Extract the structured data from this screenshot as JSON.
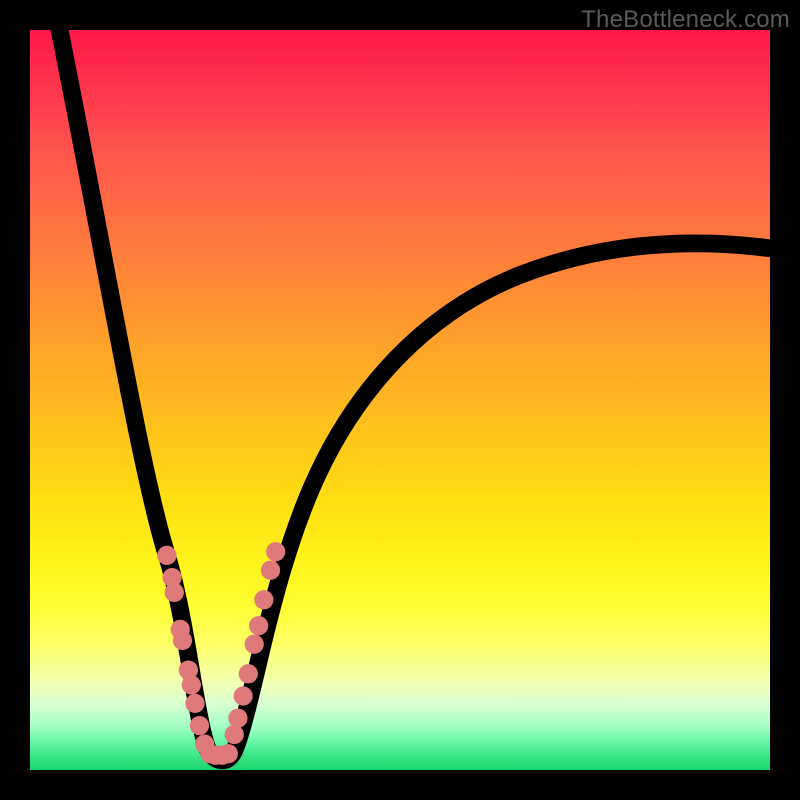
{
  "watermark": "TheBottleneck.com",
  "colors": {
    "background": "#000000",
    "dot_fill": "#e07a7a",
    "curve_stroke": "#000000",
    "gradient_top": "#ff1749",
    "gradient_bottom": "#1bd76c"
  },
  "chart_data": {
    "type": "line",
    "title": "",
    "xlabel": "",
    "ylabel": "",
    "xlim": [
      0,
      100
    ],
    "ylim": [
      0,
      100
    ],
    "series": [
      {
        "name": "bottleneck-curve",
        "curve": {
          "description": "V-shaped curve starting top-left, dipping to a flat minimum near x≈25, rising to top-right with a shallower right arm that tapers near y≈70 at x=100",
          "min_x": 25,
          "min_y": 2,
          "left_endpoint_y": 100,
          "right_endpoint_y": 70,
          "flat_bottom_width": 4
        }
      }
    ],
    "marker_points_left": [
      {
        "x": 18.5,
        "y": 29
      },
      {
        "x": 19.2,
        "y": 26
      },
      {
        "x": 19.5,
        "y": 24
      },
      {
        "x": 20.3,
        "y": 19
      },
      {
        "x": 20.6,
        "y": 17.5
      },
      {
        "x": 21.4,
        "y": 13.5
      },
      {
        "x": 21.8,
        "y": 11.5
      },
      {
        "x": 22.3,
        "y": 9
      },
      {
        "x": 22.9,
        "y": 6
      },
      {
        "x": 23.6,
        "y": 3.5
      }
    ],
    "marker_points_bottom": [
      {
        "x": 24.3,
        "y": 2.2
      },
      {
        "x": 25.1,
        "y": 2.0
      },
      {
        "x": 26.0,
        "y": 2.0
      },
      {
        "x": 26.8,
        "y": 2.2
      }
    ],
    "marker_points_right": [
      {
        "x": 27.6,
        "y": 4.8
      },
      {
        "x": 28.1,
        "y": 7
      },
      {
        "x": 28.8,
        "y": 10
      },
      {
        "x": 29.5,
        "y": 13
      },
      {
        "x": 30.3,
        "y": 17
      },
      {
        "x": 30.9,
        "y": 19.5
      },
      {
        "x": 31.6,
        "y": 23
      },
      {
        "x": 32.5,
        "y": 27
      },
      {
        "x": 33.2,
        "y": 29.5
      }
    ],
    "marker_radius": 1.3
  }
}
